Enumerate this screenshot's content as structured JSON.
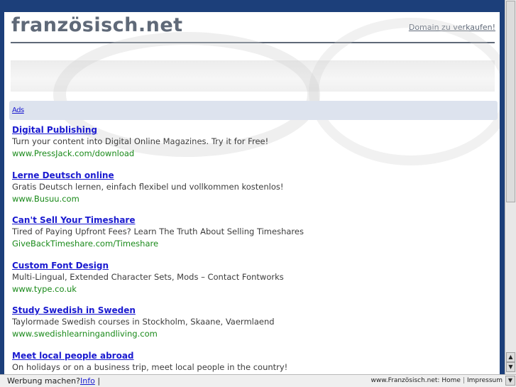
{
  "header": {
    "site_title": "französisch.net",
    "domain_link": "Domain zu verkaufen!"
  },
  "ads_label": "Ads",
  "ads": [
    {
      "title": "Digital Publishing",
      "desc": "Turn your content into Digital Online Magazines. Try it for Free!",
      "url": "www.PressJack.com/download"
    },
    {
      "title": "Lerne Deutsch online",
      "desc": "Gratis Deutsch lernen, einfach flexibel und vollkommen kostenlos!",
      "url": "www.Busuu.com"
    },
    {
      "title": "Can't Sell Your Timeshare",
      "desc": "Tired of Paying Upfront Fees? Learn The Truth About Selling Timeshares",
      "url": "GiveBackTimeshare.com/Timeshare"
    },
    {
      "title": "Custom Font Design",
      "desc": "Multi-Lingual, Extended Character Sets, Mods – Contact Fontworks",
      "url": "www.type.co.uk"
    },
    {
      "title": "Study Swedish in Sweden",
      "desc": "Taylormade Swedish courses in Stockholm, Skaane, Vaermlaend",
      "url": "www.swedishlearningandliving.com"
    },
    {
      "title": "Meet local people abroad",
      "desc": "On holidays or on a business trip, meet local people in the country!",
      "url": ""
    }
  ],
  "statusbar": {
    "left_text": "Werbung machen?",
    "info_link": "Info",
    "cursor": "|",
    "site": "www.Französisch.net:",
    "home": "Home",
    "impressum": "Impressum"
  },
  "icons": {
    "scroll_up": "▲",
    "scroll_down": "▼"
  }
}
